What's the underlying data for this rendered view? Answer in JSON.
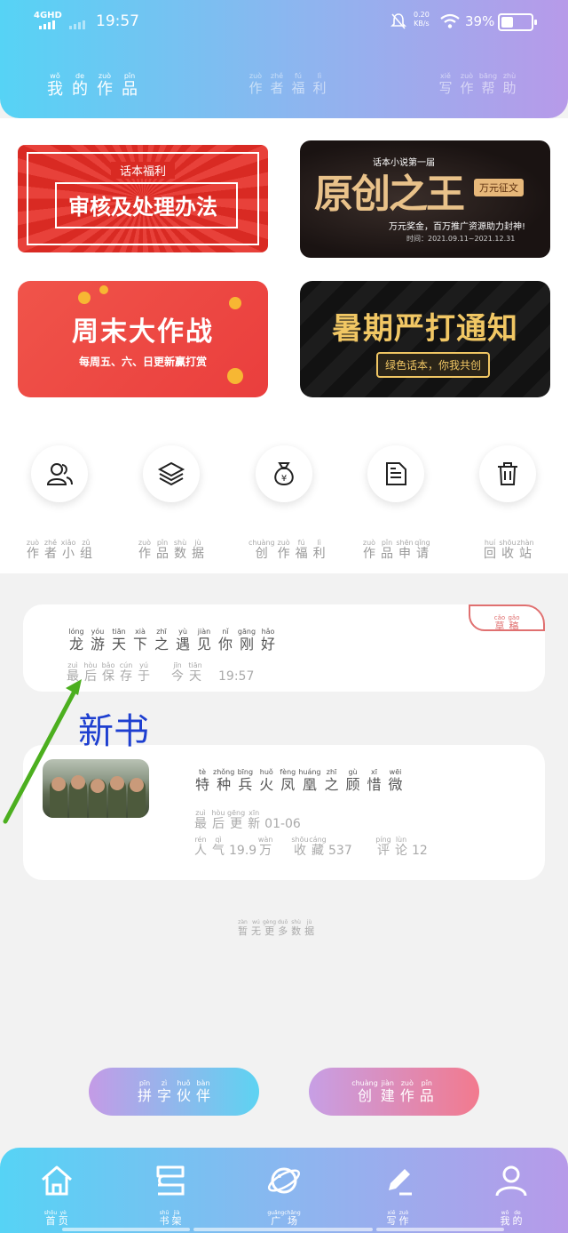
{
  "status_bar": {
    "network": "4GHD",
    "time": "19:57",
    "speed_value": "0.20",
    "speed_unit": "KB/s",
    "battery": "39%",
    "battery_level": 0.39
  },
  "header_tabs": [
    {
      "chars": [
        [
          "wǒ",
          "我"
        ],
        [
          "de",
          "的"
        ],
        [
          "zuò",
          "作"
        ],
        [
          "pǐn",
          "品"
        ]
      ],
      "active": true
    },
    {
      "chars": [
        [
          "zuò",
          "作"
        ],
        [
          "zhě",
          "者"
        ],
        [
          "fú",
          "福"
        ],
        [
          "lì",
          "利"
        ]
      ],
      "active": false
    },
    {
      "chars": [
        [
          "xiě",
          "写"
        ],
        [
          "zuò",
          "作"
        ],
        [
          "bāng",
          "帮"
        ],
        [
          "zhù",
          "助"
        ]
      ],
      "active": false
    }
  ],
  "banners": {
    "welfare": {
      "tag": "话本福利",
      "title": "审核及处理办法"
    },
    "contest": {
      "top": "话本小说第一届",
      "title": "原创之王",
      "badge": "万元征文",
      "line": "万元奖金，百万推广资源助力封神!",
      "date": "时间：2021.09.11~2021.12.31"
    },
    "weekend": {
      "title": "周末大作战",
      "subtitle": "每周五、六、日更新赢打赏"
    },
    "summer": {
      "title": "暑期严打通知",
      "pill": "绿色话本，你我共创"
    }
  },
  "tools": [
    {
      "icon": "author-group-icon",
      "chars": [
        [
          "zuò",
          "作"
        ],
        [
          "zhě",
          "者"
        ],
        [
          "xiǎo",
          "小"
        ],
        [
          "zǔ",
          "组"
        ]
      ]
    },
    {
      "icon": "layers-icon",
      "chars": [
        [
          "zuò",
          "作"
        ],
        [
          "pǐn",
          "品"
        ],
        [
          "shù",
          "数"
        ],
        [
          "jù",
          "据"
        ]
      ]
    },
    {
      "icon": "money-bag-icon",
      "chars": [
        [
          "chuàng",
          "创"
        ],
        [
          "zuò",
          "作"
        ],
        [
          "fú",
          "福"
        ],
        [
          "lì",
          "利"
        ]
      ]
    },
    {
      "icon": "document-icon",
      "chars": [
        [
          "zuò",
          "作"
        ],
        [
          "pǐn",
          "品"
        ],
        [
          "shēn",
          "申"
        ],
        [
          "qǐng",
          "请"
        ]
      ]
    },
    {
      "icon": "trash-icon",
      "chars": [
        [
          "huí",
          "回"
        ],
        [
          "shōu",
          "收"
        ],
        [
          "zhàn",
          "站"
        ]
      ]
    }
  ],
  "works": [
    {
      "draft": [
        [
          "cǎo",
          "草"
        ],
        [
          "gǎo",
          "稿"
        ]
      ],
      "title": [
        [
          "lóng",
          "龙"
        ],
        [
          "yóu",
          "游"
        ],
        [
          "tiān",
          "天"
        ],
        [
          "xià",
          "下"
        ],
        [
          "zhī",
          "之"
        ],
        [
          "yù",
          "遇"
        ],
        [
          "jiàn",
          "见"
        ],
        [
          "nǐ",
          "你"
        ],
        [
          "gāng",
          "刚"
        ],
        [
          "hǎo",
          "好"
        ]
      ],
      "saved_label": [
        [
          "zuì",
          "最"
        ],
        [
          "hòu",
          "后"
        ],
        [
          "bǎo",
          "保"
        ],
        [
          "cún",
          "存"
        ],
        [
          "yú",
          "于"
        ]
      ],
      "saved_day": [
        [
          "jīn",
          "今"
        ],
        [
          "tiān",
          "天"
        ]
      ],
      "saved_time": "19:57"
    },
    {
      "title": [
        [
          "tè",
          "特"
        ],
        [
          "zhǒng",
          "种"
        ],
        [
          "bīng",
          "兵"
        ],
        [
          "huǒ",
          "火"
        ],
        [
          "fèng",
          "凤"
        ],
        [
          "huáng",
          "凰"
        ],
        [
          "zhī",
          "之"
        ],
        [
          "gù",
          "顾"
        ],
        [
          "xī",
          "惜"
        ],
        [
          "wēi",
          "微"
        ]
      ],
      "updated_label": [
        [
          "zuì",
          "最"
        ],
        [
          "hòu",
          "后"
        ],
        [
          "gēng",
          "更"
        ],
        [
          "xīn",
          "新"
        ]
      ],
      "updated_date": "01-06",
      "popularity_label": [
        [
          "rén",
          "人"
        ],
        [
          "qì",
          "气"
        ]
      ],
      "popularity_value": "19.9",
      "popularity_unit": [
        [
          "wàn",
          "万"
        ]
      ],
      "collect_label": [
        [
          "shōu",
          "收"
        ],
        [
          "cáng",
          "藏"
        ]
      ],
      "collect_value": "537",
      "comment_label": [
        [
          "píng",
          "评"
        ],
        [
          "lùn",
          "论"
        ]
      ],
      "comment_value": "12"
    }
  ],
  "annotation": {
    "label": "新书",
    "color": "#1e3fd0",
    "arrow_color": "#4caf1f"
  },
  "no_more": [
    [
      "zàn",
      "暂"
    ],
    [
      "wú",
      "无"
    ],
    [
      "gèng",
      "更"
    ],
    [
      "duō",
      "多"
    ],
    [
      "shù",
      "数"
    ],
    [
      "jù",
      "据"
    ]
  ],
  "buttons": {
    "partner": [
      [
        "pīn",
        "拼"
      ],
      [
        "zì",
        "字"
      ],
      [
        "huǒ",
        "伙"
      ],
      [
        "bàn",
        "伴"
      ]
    ],
    "create": [
      [
        "chuàng",
        "创"
      ],
      [
        "jiàn",
        "建"
      ],
      [
        "zuò",
        "作"
      ],
      [
        "pǐn",
        "品"
      ]
    ]
  },
  "tabbar": [
    {
      "icon": "home-icon",
      "chars": [
        [
          "shǒu",
          "首"
        ],
        [
          "yè",
          "页"
        ]
      ]
    },
    {
      "icon": "bookshelf-icon",
      "chars": [
        [
          "shū",
          "书"
        ],
        [
          "jià",
          "架"
        ]
      ]
    },
    {
      "icon": "planet-icon",
      "chars": [
        [
          "guǎng",
          "广"
        ],
        [
          "chǎng",
          "场"
        ]
      ]
    },
    {
      "icon": "pen-icon",
      "chars": [
        [
          "xiě",
          "写"
        ],
        [
          "zuò",
          "作"
        ]
      ]
    },
    {
      "icon": "profile-icon",
      "chars": [
        [
          "wǒ",
          "我"
        ],
        [
          "de",
          "的"
        ]
      ]
    }
  ]
}
